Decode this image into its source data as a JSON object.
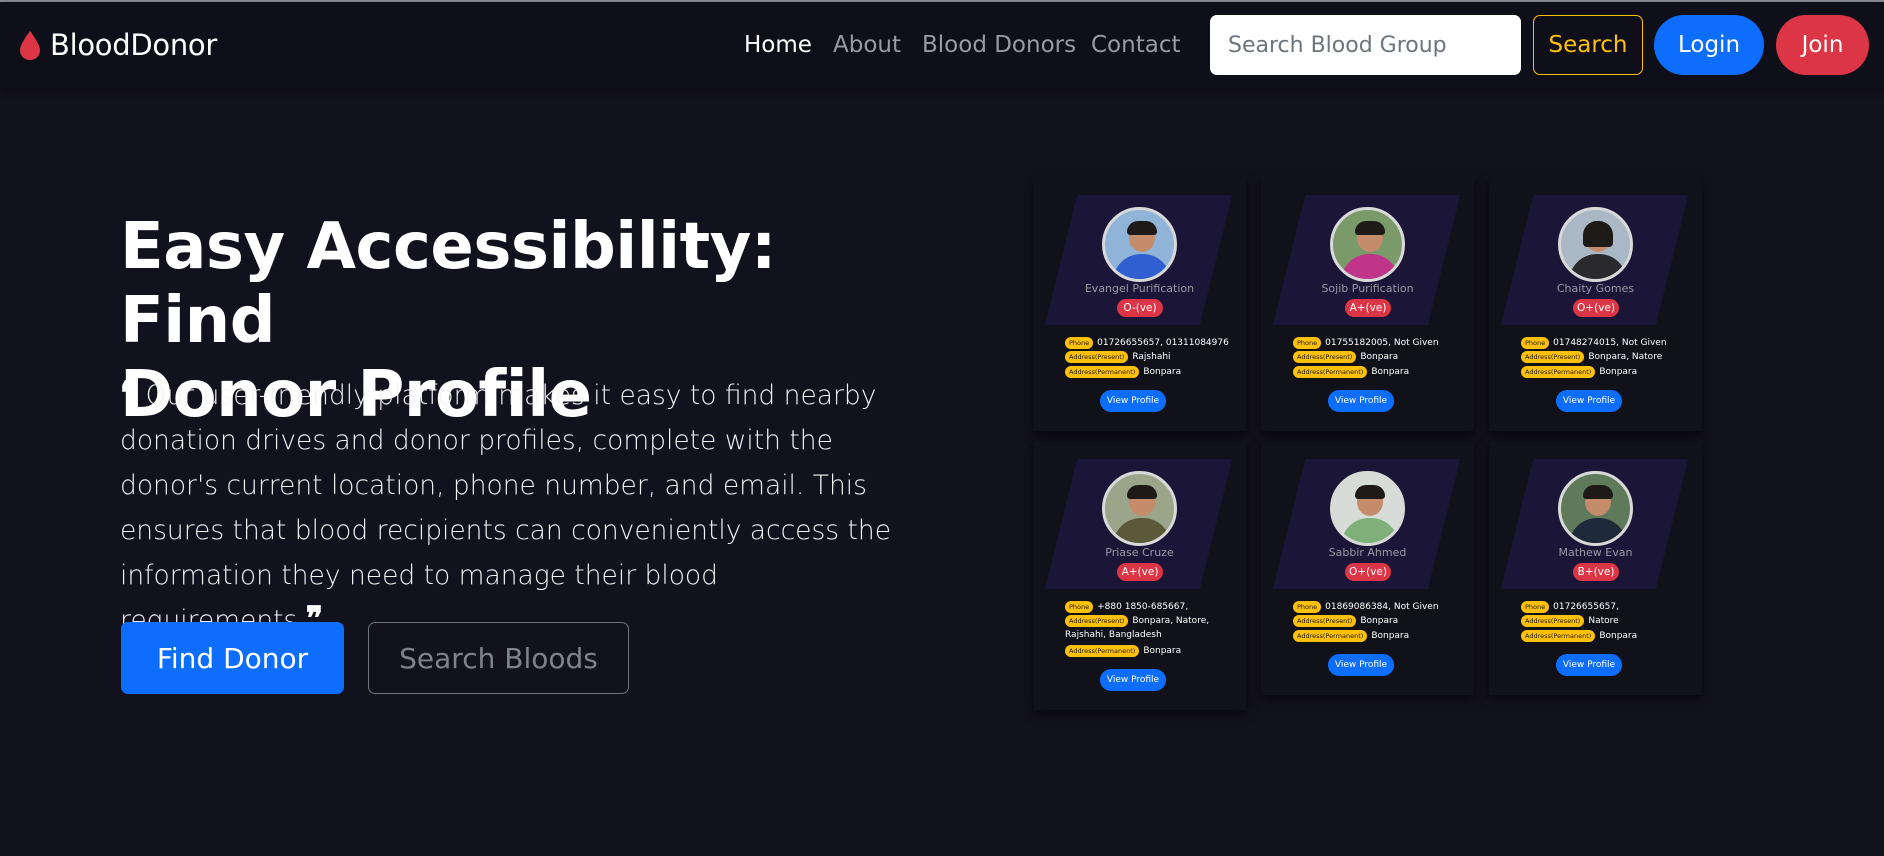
{
  "nav": {
    "brand": "BloodDonor",
    "links": [
      "Home",
      "About",
      "Blood Donors",
      "Contact"
    ],
    "search_placeholder": "Search Blood Group",
    "search_label": "Search",
    "login_label": "Login",
    "join_label": "Join"
  },
  "hero": {
    "title_line1": "Easy Accessibility: Find",
    "title_line2": "Donor Profile",
    "open_quote": "❝",
    "close_quote": "❞",
    "description": "Our user-friendly platform makes it easy to find nearby donation drives and donor profiles, complete with the donor's current location, phone number, and email. This ensures that blood recipients can conveniently access the information they need to manage their blood requirements.",
    "find_donor_label": "Find Donor",
    "search_bloods_label": "Search Bloods"
  },
  "labels": {
    "phone": "Phone",
    "present": "Address(Present)",
    "permanent": "Address(Permanent)",
    "view_profile": "View Profile"
  },
  "colors": {
    "primary": "#0d6efd",
    "danger": "#dc3545",
    "warning": "#ffc107",
    "background": "#12111e"
  },
  "donors": [
    {
      "name": "Evangel Purification",
      "blood": "O-(ve)",
      "phone": "01726655657, 01311084976",
      "present_lines": [
        "Rajshahi"
      ],
      "permanent": "Bonpara",
      "shirt": "#2f5fd0"
    },
    {
      "name": "Sojib Purification",
      "blood": "A+(ve)",
      "phone": "01755182005, Not Given",
      "present_lines": [
        "Bonpara"
      ],
      "permanent": "Bonpara",
      "shirt": "#c0358a"
    },
    {
      "name": "Chaity Gomes",
      "blood": "O+(ve)",
      "phone": "01748274015, Not Given",
      "present_lines": [
        "Bonpara, Natore"
      ],
      "permanent": "Bonpara",
      "shirt": "#2a2a2e"
    },
    {
      "name": "Priase Cruze",
      "blood": "A+(ve)",
      "phone": "+880 1850-685667,",
      "present_lines": [
        "Bonpara, Natore,",
        "Rajshahi, Bangladesh"
      ],
      "permanent": "Bonpara",
      "shirt": "#5a5a3a"
    },
    {
      "name": "Sabbir Ahmed",
      "blood": "O+(ve)",
      "phone": "01869086384, Not Given",
      "present_lines": [
        "Bonpara"
      ],
      "permanent": "Bonpara",
      "shirt": "#7fb07a"
    },
    {
      "name": "Mathew Evan",
      "blood": "B+(ve)",
      "phone": "01726655657,",
      "present_lines": [
        "Natore"
      ],
      "permanent": "Bonpara",
      "shirt": "#1e2a3a"
    }
  ]
}
